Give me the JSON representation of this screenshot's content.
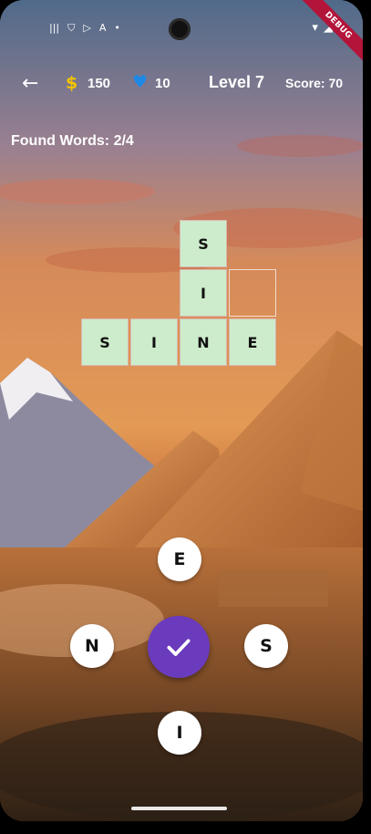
{
  "status_bar": {
    "left_icons": [
      "|||",
      "⛉",
      "▷",
      "A",
      "•"
    ],
    "right_icons": [
      "▾",
      "◢",
      "▮"
    ],
    "debug_label": "DEBUG"
  },
  "app_bar": {
    "back_icon": "←",
    "coin_icon": "$",
    "coins": "150",
    "heart_icon": "♥",
    "lives": "10",
    "level": "Level 7",
    "score": "Score: 70"
  },
  "found_words": "Found Words: 2/4",
  "grid": {
    "cells": [
      {
        "letter": "S",
        "filled": true
      },
      {
        "letter": "I",
        "filled": true
      },
      {
        "letter": "",
        "filled": false
      },
      {
        "letter": "S",
        "filled": true
      },
      {
        "letter": "I",
        "filled": true
      },
      {
        "letter": "N",
        "filled": true
      },
      {
        "letter": "E",
        "filled": true
      }
    ]
  },
  "wheel": {
    "top": "E",
    "left": "N",
    "right": "S",
    "bottom": "I",
    "submit_icon": "check-icon"
  },
  "colors": {
    "cell_fill": "#cdeccb",
    "submit_button": "#6a3bbd",
    "coin": "#f2c300",
    "heart": "#1e88e5",
    "debug_ribbon": "#b3143a"
  }
}
